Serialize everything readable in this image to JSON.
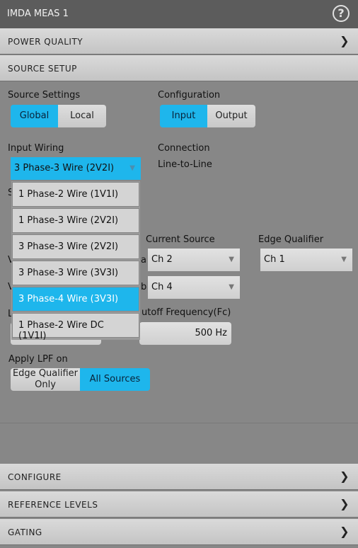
{
  "header": {
    "title": "IMDA MEAS 1",
    "help_icon": "question-circle-icon"
  },
  "sections": {
    "power_quality": "POWER QUALITY",
    "source_setup": "SOURCE SETUP",
    "configure": "CONFIGURE",
    "reference_levels": "REFERENCE LEVELS",
    "gating": "GATING"
  },
  "source_settings": {
    "label": "Source Settings",
    "options": [
      "Global",
      "Local"
    ],
    "selected": "Global"
  },
  "configuration": {
    "label": "Configuration",
    "options": [
      "Input",
      "Output"
    ],
    "selected": "Input"
  },
  "input_wiring": {
    "label": "Input Wiring",
    "value": "3 Phase-3 Wire (2V2I)",
    "options": [
      "1 Phase-2 Wire (1V1I)",
      "1 Phase-3 Wire (2V2I)",
      "3 Phase-3 Wire (2V2I)",
      "3 Phase-3 Wire (3V3I)",
      "3 Phase-4 Wire (3V3I)",
      "1 Phase-2 Wire DC (1V1I)"
    ],
    "highlighted": "3 Phase-4 Wire (3V3I)"
  },
  "connection": {
    "label": "Connection",
    "value": "Line-to-Line"
  },
  "hidden_fragments": {
    "s": "S",
    "v1": "V",
    "a": "a",
    "v2": "V",
    "b": "b",
    "l": "L"
  },
  "current_source": {
    "label": "Current Source",
    "row1": "Ch 2",
    "row2": "Ch 4"
  },
  "edge_qualifier": {
    "label": "Edge Qualifier",
    "value": "Ch 1"
  },
  "cutoff": {
    "label": "utoff Frequency(Fc)",
    "value": "500 Hz"
  },
  "apply_lpf": {
    "label": "Apply LPF on",
    "options": [
      "Edge Qualifier Only",
      "All Sources"
    ],
    "selected": "All Sources"
  },
  "colors": {
    "accent": "#1eb6ec",
    "background": "#878787",
    "header": "#5c5c5c"
  }
}
